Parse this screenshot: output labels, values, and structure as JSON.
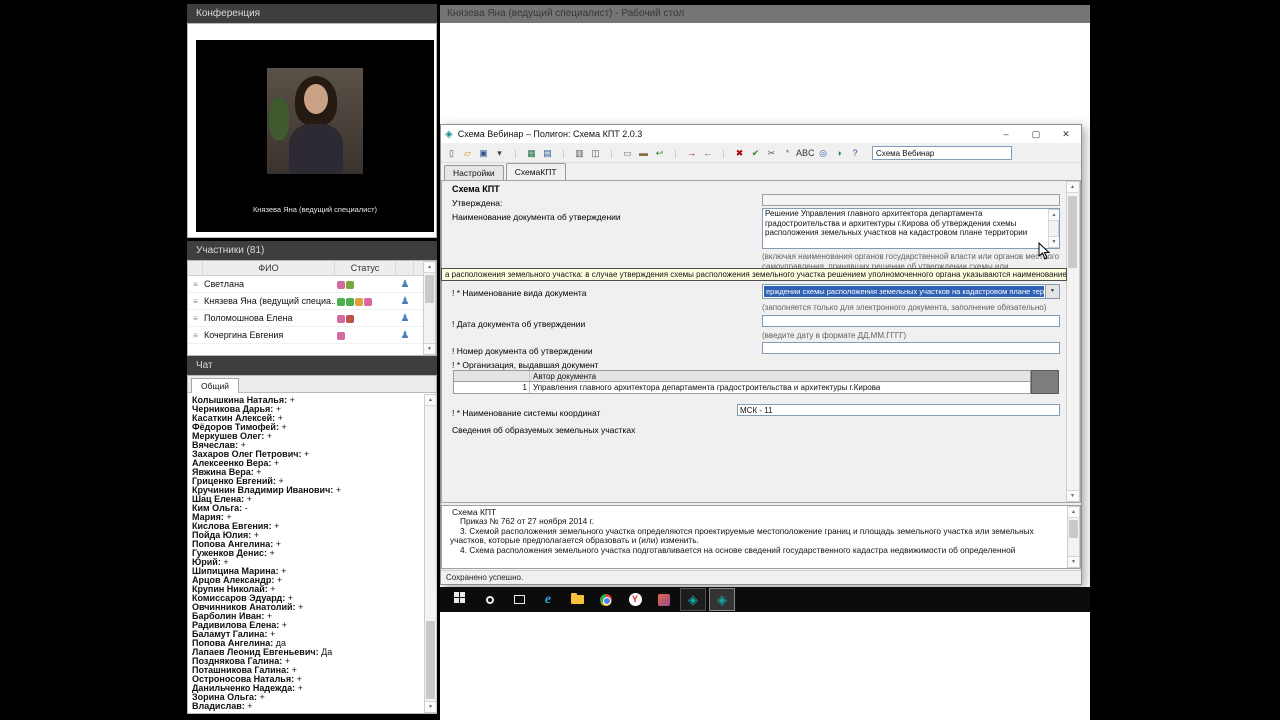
{
  "icons": {
    "minimize": "–",
    "maximize": "▢",
    "close": "✕",
    "dropdown": "▼",
    "arrow_up": "▲",
    "arrow_down": "▼",
    "row_menu": "≡",
    "person": "♟",
    "edge": "e",
    "yandex": "Y",
    "polygon": "◈",
    "window_app": "◈"
  },
  "conference": {
    "title": "Конференция",
    "video_caption": "Князева Яна (ведущий специалист)"
  },
  "participants": {
    "title": "Участники (81)",
    "col_fio": "ФИО",
    "col_status": "Статус",
    "rows": [
      {
        "name": "Светлана",
        "icons": [
          "#d46a9e",
          "#7aa83d"
        ]
      },
      {
        "name": "Князева Яна (ведущий специа...",
        "icons": [
          "#4caf50",
          "#4caf50",
          "#e0a23c",
          "#d46a9e"
        ]
      },
      {
        "name": "Поломошнова Елена",
        "icons": [
          "#d46a9e",
          "#c0504d"
        ]
      },
      {
        "name": "Кочергина Евгения",
        "icons": [
          "#d46a9e"
        ]
      }
    ]
  },
  "chat": {
    "title": "Чат",
    "tab": "Общий",
    "messages": [
      {
        "n": "Колышкина Наталья:",
        "t": "+"
      },
      {
        "n": "Черникова Дарья:",
        "t": "+"
      },
      {
        "n": "Касаткин Алексей:",
        "t": "+"
      },
      {
        "n": "Фёдоров Тимофей:",
        "t": "+"
      },
      {
        "n": "Меркушев Олег:",
        "t": "+"
      },
      {
        "n": "Вячеслав:",
        "t": "+"
      },
      {
        "n": "Захаров Олег Петрович:",
        "t": "+"
      },
      {
        "n": "Алексеенко Вера:",
        "t": "+"
      },
      {
        "n": "Явжина Вера:",
        "t": "+"
      },
      {
        "n": "Гриценко Евгений:",
        "t": "+"
      },
      {
        "n": "Кручинин Владимир Иванович:",
        "t": "+"
      },
      {
        "n": "Шац Елена:",
        "t": "+"
      },
      {
        "n": "Ким Ольга:",
        "t": "-"
      },
      {
        "n": "Мария:",
        "t": "+"
      },
      {
        "n": "Кислова Евгения:",
        "t": "+"
      },
      {
        "n": "Пойда Юлия:",
        "t": "+"
      },
      {
        "n": "Попова Ангелина:",
        "t": "+"
      },
      {
        "n": "Гуженков Денис:",
        "t": "+"
      },
      {
        "n": "Юрий:",
        "t": "+"
      },
      {
        "n": "Шипицина Марина:",
        "t": "+"
      },
      {
        "n": "Арцов Александр:",
        "t": "+"
      },
      {
        "n": "Крупин Николай:",
        "t": "+"
      },
      {
        "n": "Комиссаров Эдуард:",
        "t": "+"
      },
      {
        "n": "Овчинников Анатолий:",
        "t": "+"
      },
      {
        "n": "Барболин Иван:",
        "t": "+"
      },
      {
        "n": "Радивилова Елена:",
        "t": "+"
      },
      {
        "n": "Баламут Галина:",
        "t": "+"
      },
      {
        "n": "Попова Ангелина:",
        "t": "да"
      },
      {
        "n": "Лапаев Леонид Евгеньевич:",
        "t": "Да"
      },
      {
        "n": "Позднякова Галина:",
        "t": "+"
      },
      {
        "n": "Поташникова Галина:",
        "t": "+"
      },
      {
        "n": "Остроносова Наталья:",
        "t": "+"
      },
      {
        "n": "Данильченко Надежда:",
        "t": "+"
      },
      {
        "n": "Зорина Ольга:",
        "t": "+"
      },
      {
        "n": "Владислав:",
        "t": "+"
      }
    ]
  },
  "share": {
    "title": "Князева Яна (ведущий специалист) - Рабочий стол"
  },
  "window": {
    "title": "Схема Вебинар – Полигон: Схема КПТ 2.0.3",
    "toolbar": {
      "search_value": "Схема Вебинар",
      "icons": [
        {
          "g": "▯",
          "c": "#5a5a5a",
          "n": "new-icon"
        },
        {
          "g": "▱",
          "c": "#c9972b",
          "n": "open-icon"
        },
        {
          "g": "▣",
          "c": "#2f5496",
          "n": "save-icon"
        },
        {
          "g": "▾",
          "c": "#444444",
          "n": "save-menu-icon"
        },
        {
          "g": "|",
          "c": "#c0c0c0",
          "n": "separator"
        },
        {
          "g": "▦",
          "c": "#217346",
          "n": "excel-icon"
        },
        {
          "g": "▤",
          "c": "#2b579a",
          "n": "word-icon"
        },
        {
          "g": "|",
          "c": "#c0c0c0",
          "n": "separator"
        },
        {
          "g": "▥",
          "c": "#5a5a5a",
          "n": "print-icon"
        },
        {
          "g": "◫",
          "c": "#5a5a5a",
          "n": "print-preview-icon"
        },
        {
          "g": "|",
          "c": "#c0c0c0",
          "n": "separator"
        },
        {
          "g": "▭",
          "c": "#777777",
          "n": "copy-icon"
        },
        {
          "g": "▬",
          "c": "#8a6d3b",
          "n": "paste-icon"
        },
        {
          "g": "↩",
          "c": "#2e7d32",
          "n": "undo-icon"
        },
        {
          "g": "|",
          "c": "#c0c0c0",
          "n": "separator"
        },
        {
          "g": "→",
          "c": "#b00000",
          "n": "import-xml-icon"
        },
        {
          "g": "←",
          "c": "#2e7d32",
          "n": "export-xml-icon"
        },
        {
          "g": "|",
          "c": "#c0c0c0",
          "n": "separator"
        },
        {
          "g": "✖",
          "c": "#b00000",
          "n": "delete-icon"
        },
        {
          "g": "✔",
          "c": "#2e7d32",
          "n": "check-icon"
        },
        {
          "g": "✂",
          "c": "#5a5a5a",
          "n": "cut-icon"
        },
        {
          "g": "*",
          "c": "#8a6d3b",
          "n": "tools-icon"
        },
        {
          "g": "ABC",
          "c": "#333333",
          "n": "spellcheck-icon"
        },
        {
          "g": "◎",
          "c": "#2b579a",
          "n": "globe-icon"
        },
        {
          "g": "◑",
          "c": "#0e7c7b",
          "n": "clock-icon"
        },
        {
          "g": "?",
          "c": "#2b579a",
          "n": "help-icon"
        }
      ]
    },
    "tabs": [
      {
        "label": "Настройки",
        "cls": ""
      },
      {
        "label": "СхемаКПТ",
        "cls": "active"
      }
    ],
    "form": {
      "group_title": "Схема КПТ",
      "approved_label": "Утверждена:",
      "doc_name_label": "Наименование документа об утверждении",
      "doc_name_value": "Решение Управления главного архитектора департамента градостроительства и архитектуры г.Кирова об утверждении схемы расположения земельных участков на кадастровом плане территории",
      "doc_name_hint": "(включая наименования органов государственной власти или органов местного самоуправления, принявших решение об утверждении схемы или подписавших соглашение",
      "tooltip": "а расположения земельного участка: в случае утверждения схемы расположения земельного участка решением уполномоченного органа указываются наименование вида документа",
      "doc_type_label": "! * Наименование вида документа",
      "doc_type_value": "ерждении схемы расположения земельных участков на кадастровом плане территории",
      "doc_type_hint": "(заполняется только для электронного документа, заполнение обязательно)",
      "doc_date_label": "! Дата документа об утверждении",
      "doc_date_hint": "(введите дату в формате ДД.ММ.ГГГГ)",
      "doc_number_label": "! Номер документа об утверждении",
      "org_label": "! * Организация, выдавшая документ",
      "org_table_header": "Автор документа",
      "org_row_index": "1",
      "org_row_value": "Управления главного архитектора департамента градостроительства и архитектуры г.Кирова",
      "coords_label": "! * Наименование системы координат",
      "coords_value": "МСК - 11",
      "parcels_label": "Сведения об образуемых земельных участках"
    },
    "reference": {
      "title": "Схема КПТ",
      "lines": [
        "Приказ № 762 от 27 ноября 2014 г.",
        "3. Схемой расположения земельного участка определяются проектируемые местоположение границ и площадь земельного участка или земельных участков, которые предполагается образовать и (или) изменить.",
        "4. Схема расположения земельного участка подготавливается на основе сведений государственного кадастра недвижимости об определенной"
      ]
    },
    "status": "Сохранено успешно."
  }
}
